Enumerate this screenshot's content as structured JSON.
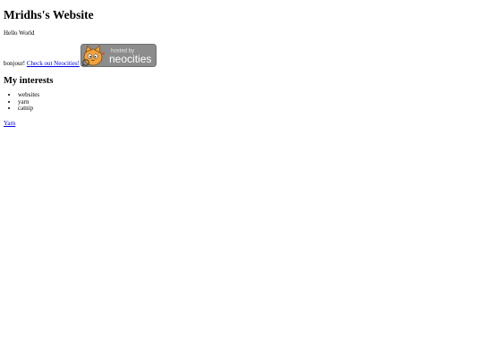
{
  "page": {
    "title": "Mridhs's Website",
    "greeting": "Hello World",
    "bonjour": "bonjour!",
    "neocities_link": "Check out Neocities!",
    "badge": {
      "top_text": "hosted by",
      "brand_text": "neocities",
      "bg_color": "#8c8c8c",
      "mascot_color": "#f2a23a"
    },
    "interests_heading": "My interests",
    "interests": [
      "websites",
      "yarn",
      "catnip"
    ],
    "yarn_link": "Yarn"
  },
  "colors": {
    "link": "#0000ee",
    "text": "#000000",
    "background": "#ffffff"
  }
}
